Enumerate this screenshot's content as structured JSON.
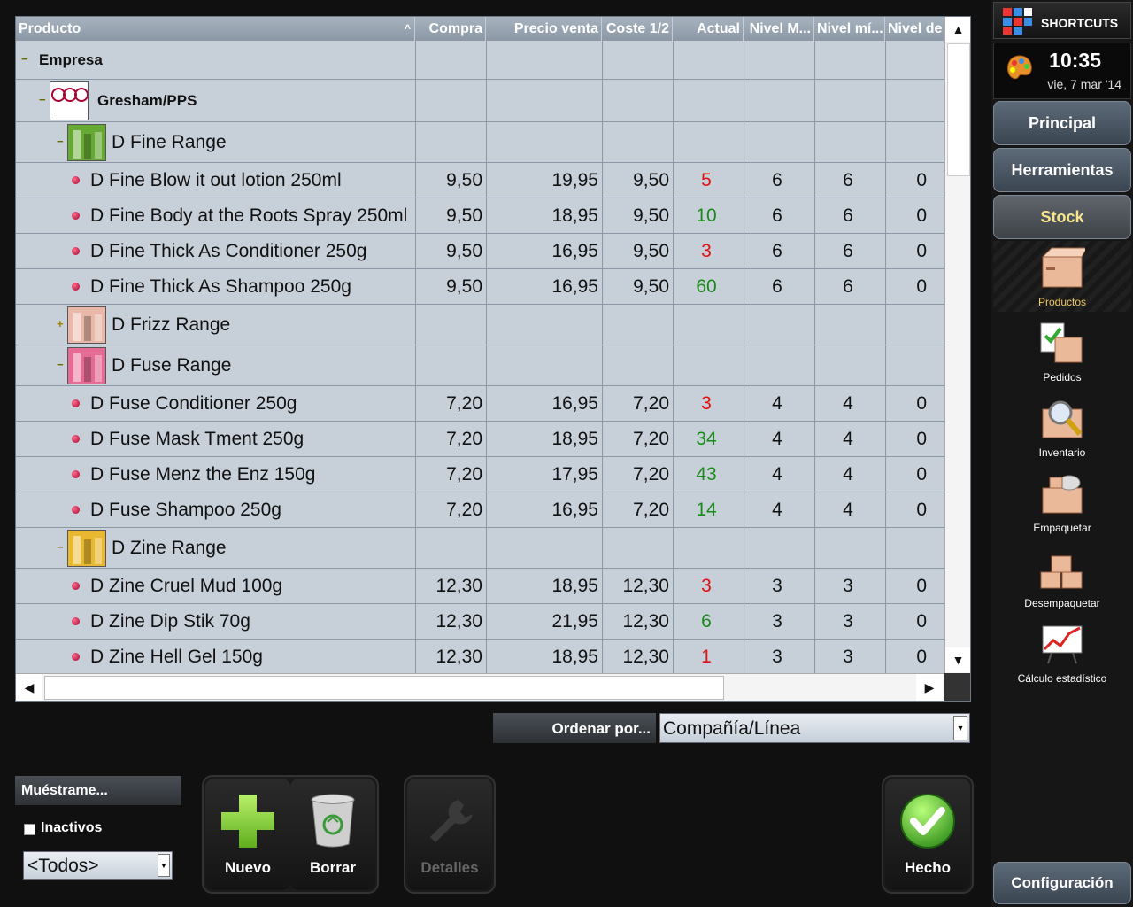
{
  "grid": {
    "columns": [
      "Producto",
      "Compra",
      "Precio venta",
      "Coste 1/2",
      "Actual",
      "Nivel M...",
      "Nivel mí...",
      "Nivel de"
    ],
    "rows": [
      {
        "type": "group",
        "level": 0,
        "label": "Empresa",
        "expanded": true
      },
      {
        "type": "group",
        "level": 1,
        "label": "Gresham/PPS",
        "expanded": true,
        "thumb": "pps-logo"
      },
      {
        "type": "group",
        "level": 2,
        "label": "D Fine Range",
        "expanded": true,
        "thumb": "fine-range"
      },
      {
        "type": "item",
        "label": "D Fine Blow it out lotion 250ml",
        "compra": "9,50",
        "venta": "19,95",
        "coste": "9,50",
        "actual": "5",
        "actual_status": "red",
        "nivel_max": "6",
        "nivel_min": "6",
        "nivel_de": "0"
      },
      {
        "type": "item",
        "label": "D Fine Body at the Roots Spray 250ml",
        "compra": "9,50",
        "venta": "18,95",
        "coste": "9,50",
        "actual": "10",
        "actual_status": "green",
        "nivel_max": "6",
        "nivel_min": "6",
        "nivel_de": "0"
      },
      {
        "type": "item",
        "label": "D Fine Thick As Conditioner 250g",
        "compra": "9,50",
        "venta": "16,95",
        "coste": "9,50",
        "actual": "3",
        "actual_status": "red",
        "nivel_max": "6",
        "nivel_min": "6",
        "nivel_de": "0"
      },
      {
        "type": "item",
        "label": "D Fine Thick As Shampoo 250g",
        "compra": "9,50",
        "venta": "16,95",
        "coste": "9,50",
        "actual": "60",
        "actual_status": "green",
        "nivel_max": "6",
        "nivel_min": "6",
        "nivel_de": "0"
      },
      {
        "type": "group",
        "level": 2,
        "label": "D Frizz Range",
        "expanded": false,
        "thumb": "frizz-range"
      },
      {
        "type": "group",
        "level": 2,
        "label": "D Fuse Range",
        "expanded": true,
        "thumb": "fuse-range"
      },
      {
        "type": "item",
        "label": "D Fuse Conditioner 250g",
        "compra": "7,20",
        "venta": "16,95",
        "coste": "7,20",
        "actual": "3",
        "actual_status": "red",
        "nivel_max": "4",
        "nivel_min": "4",
        "nivel_de": "0"
      },
      {
        "type": "item",
        "label": "D Fuse Mask Tment 250g",
        "compra": "7,20",
        "venta": "18,95",
        "coste": "7,20",
        "actual": "34",
        "actual_status": "green",
        "nivel_max": "4",
        "nivel_min": "4",
        "nivel_de": "0"
      },
      {
        "type": "item",
        "label": "D Fuse Menz the Enz 150g",
        "compra": "7,20",
        "venta": "17,95",
        "coste": "7,20",
        "actual": "43",
        "actual_status": "green",
        "nivel_max": "4",
        "nivel_min": "4",
        "nivel_de": "0"
      },
      {
        "type": "item",
        "label": "D Fuse Shampoo 250g",
        "compra": "7,20",
        "venta": "16,95",
        "coste": "7,20",
        "actual": "14",
        "actual_status": "green",
        "nivel_max": "4",
        "nivel_min": "4",
        "nivel_de": "0"
      },
      {
        "type": "group",
        "level": 2,
        "label": "D Zine Range",
        "expanded": true,
        "thumb": "zine-range"
      },
      {
        "type": "item",
        "label": "D Zine Cruel Mud 100g",
        "compra": "12,30",
        "venta": "18,95",
        "coste": "12,30",
        "actual": "3",
        "actual_status": "red",
        "nivel_max": "3",
        "nivel_min": "3",
        "nivel_de": "0"
      },
      {
        "type": "item",
        "label": "D Zine Dip Stik 70g",
        "compra": "12,30",
        "venta": "21,95",
        "coste": "12,30",
        "actual": "6",
        "actual_status": "green",
        "nivel_max": "3",
        "nivel_min": "3",
        "nivel_de": "0"
      },
      {
        "type": "item",
        "label": "D Zine Hell Gel 150g",
        "compra": "12,30",
        "venta": "18,95",
        "coste": "12,30",
        "actual": "1",
        "actual_status": "red",
        "nivel_max": "3",
        "nivel_min": "3",
        "nivel_de": "0"
      }
    ]
  },
  "sort": {
    "label": "Ordenar por...",
    "value": "Compañía/Línea"
  },
  "showme": {
    "title": "Muéstrame...",
    "inactive_label": "Inactivos",
    "inactive_checked": false,
    "filter_value": "<Todos>"
  },
  "actions": {
    "new_label": "Nuevo",
    "delete_label": "Borrar",
    "details_label": "Detalles",
    "done_label": "Hecho"
  },
  "sidebar": {
    "shortcuts_label": "SHORTCUTS",
    "time": "10:35",
    "date": "vie, 7 mar '14",
    "nav": [
      "Principal",
      "Herramientas",
      "Stock"
    ],
    "active_nav": "Stock",
    "items": [
      {
        "label": "Productos",
        "icon": "box-icon",
        "active": true
      },
      {
        "label": "Pedidos",
        "icon": "orders-icon",
        "active": false
      },
      {
        "label": "Inventario",
        "icon": "inventory-icon",
        "active": false
      },
      {
        "label": "Empaquetar",
        "icon": "pack-icon",
        "active": false
      },
      {
        "label": "Desempaquetar",
        "icon": "unpack-icon",
        "active": false
      },
      {
        "label": "Cálculo estadístico",
        "icon": "stats-icon",
        "active": false
      }
    ],
    "config_label": "Configuración"
  },
  "colors": {
    "red": "#e01010",
    "green": "#1a8a1a",
    "active_nav_text": "#f7e58b"
  }
}
